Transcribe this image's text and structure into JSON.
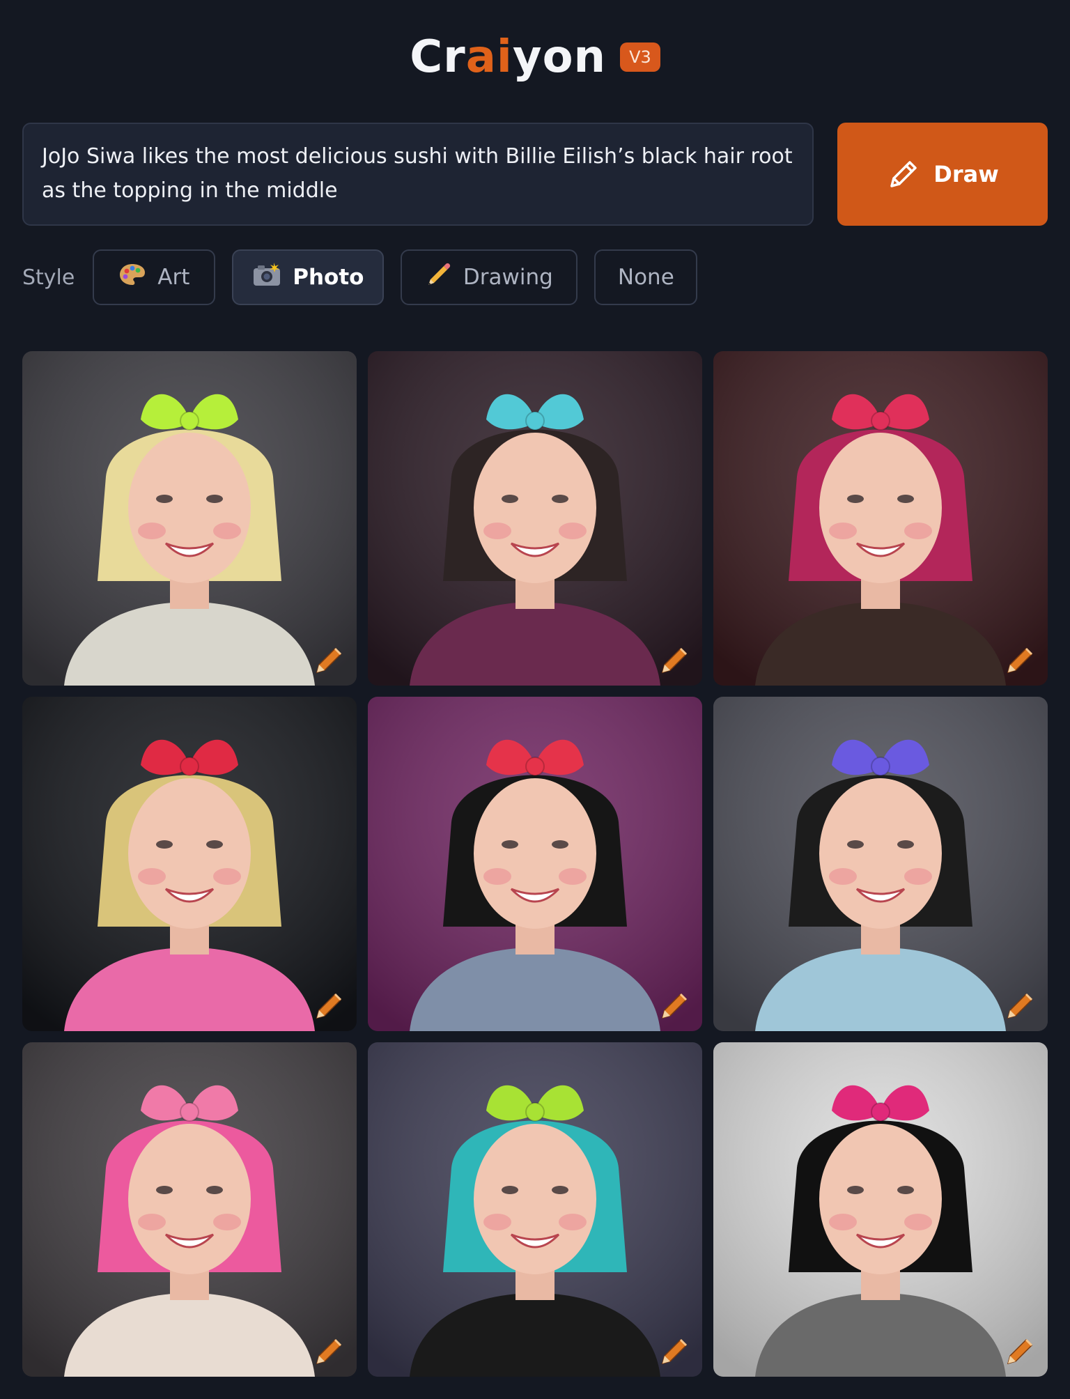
{
  "header": {
    "logo_prefix": "Cr",
    "logo_ai": "ai",
    "logo_suffix": "yon",
    "version": "V3"
  },
  "prompt": {
    "text": "JoJo Siwa likes the most delicious sushi with Billie Eilish’s black hair root as the topping in the middle"
  },
  "draw_button": {
    "label": "Draw",
    "icon": "pencil-icon"
  },
  "style": {
    "label": "Style",
    "options": [
      {
        "label": "Art",
        "icon": "palette-icon",
        "selected": false
      },
      {
        "label": "Photo",
        "icon": "camera-flash-icon",
        "selected": true
      },
      {
        "label": "Drawing",
        "icon": "pencil-icon",
        "selected": false
      },
      {
        "label": "None",
        "icon": "",
        "selected": false
      }
    ]
  },
  "results": {
    "count": 9,
    "edit_icon": "pencil-icon",
    "images": [
      {
        "bg": "#3b3a40",
        "hair": "#e8da9a",
        "bow": "#b6ef3a",
        "outfit": "#d8d6cc"
      },
      {
        "bg": "#2a1a24",
        "hair": "#2d2424",
        "bow": "#52c9d6",
        "outfit": "#6a2a4e"
      },
      {
        "bg": "#3a1a1e",
        "hair": "#b3265a",
        "bow": "#e0305a",
        "outfit": "#3a2a26"
      },
      {
        "bg": "#14161b",
        "hair": "#d9c47a",
        "bow": "#e02a44",
        "outfit": "#e96aa8"
      },
      {
        "bg": "#6e2460",
        "hair": "#161616",
        "bow": "#e5334a",
        "outfit": "#7f8fa8"
      },
      {
        "bg": "#4c4d57",
        "hair": "#1c1c1c",
        "bow": "#6a5ae0",
        "outfit": "#9fc6d8"
      },
      {
        "bg": "#3f3b3f",
        "hair": "#ec5a9e",
        "bow": "#f07aa8",
        "outfit": "#e8dcd2"
      },
      {
        "bg": "#3c3b52",
        "hair": "#2fb6b8",
        "bow": "#a8e234",
        "outfit": "#1a1a1a"
      },
      {
        "bg": "#dcdcdc",
        "hair": "#111111",
        "bow": "#e02a7a",
        "outfit": "#6a6a6a"
      }
    ]
  },
  "colors": {
    "background": "#141822",
    "accent": "#d05818",
    "panel": "#1e2433"
  }
}
